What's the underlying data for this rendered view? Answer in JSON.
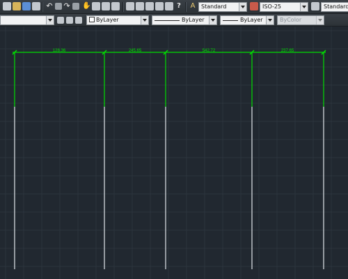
{
  "toolbar1": {
    "text_style_value": "Standard",
    "dim_style_value": "ISO-25",
    "table_style_value": "Standard"
  },
  "toolbar2": {
    "color_value": "ByLayer",
    "linetype_value": "ByLayer",
    "lineweight_value": "ByLayer",
    "plotstyle_value": "ByColor"
  },
  "drawing": {
    "dimension_labels": [
      "128.36",
      "245.65",
      "542.72",
      "237.65"
    ],
    "colors": {
      "background": "#212830",
      "dimension": "#00e000",
      "gridline": "#2c343d",
      "column_line": "#c8cdd2"
    }
  }
}
